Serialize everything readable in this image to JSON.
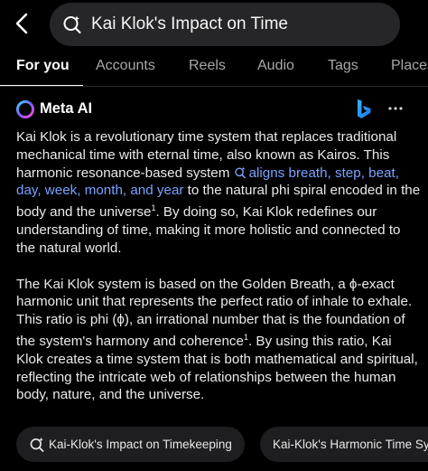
{
  "search": {
    "query": "Kai Klok's Impact on Time"
  },
  "tabs": [
    {
      "label": "For you",
      "active": true
    },
    {
      "label": "Accounts",
      "active": false
    },
    {
      "label": "Reels",
      "active": false
    },
    {
      "label": "Audio",
      "active": false
    },
    {
      "label": "Tags",
      "active": false
    },
    {
      "label": "Places",
      "active": false
    }
  ],
  "meta_ai": {
    "name": "Meta AI"
  },
  "answer": {
    "p1_before": "Kai Klok is a revolutionary time system that replaces traditional mechanical time with eternal time, also known as Kairos. This harmonic resonance-based system ",
    "p1_link": "aligns breath, step, beat, day, week, month, and year",
    "p1_after": " to the natural phi spiral encoded in the body and the universe",
    "p1_cite": "1",
    "p1_end": ". By doing so, Kai Klok redefines our understanding of time, making it more holistic and connected to the natural world.",
    "p2_before": "The Kai Klok system is based on the Golden Breath, a ϕ-exact harmonic unit that represents the perfect ratio of inhale to exhale. This ratio is phi (ϕ), an irrational number that is the foundation of the system's harmony and coherence",
    "p2_cite": "1",
    "p2_end": ". By using this ratio, Kai Klok creates a time system that is both mathematical and spiritual, reflecting the intricate web of relationships between the human body, nature, and the universe."
  },
  "suggestions": [
    {
      "label": "Kai-Klok's Impact on Timekeeping",
      "icon": "meta-ai-search-icon"
    },
    {
      "label": "Kai-Klok's Harmonic Time System",
      "icon": ""
    }
  ],
  "colors": {
    "background": "#000000",
    "link": "#7aa2ff",
    "search_bg": "#262628",
    "chip_bg": "#1e1e20"
  }
}
